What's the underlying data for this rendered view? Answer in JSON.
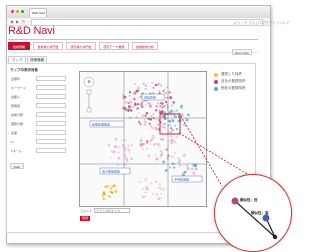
{
  "browser": {
    "tab_label": "R&D Navi",
    "back_glyph": "◀",
    "forward_glyph": "▶",
    "reload_glyph": "↻"
  },
  "header": {
    "brand": "R&D Navi",
    "user_links": "ようこそ さん  | ログアウト  | ヘルプ"
  },
  "main_tabs": [
    "技術俯瞰",
    "技術者の専門性",
    "研究者の専門性",
    "研究テーマ推薦",
    "技術動向分析"
  ],
  "reset_label": "Reset filter",
  "sub_tabs": [
    "マップ",
    "詳細情報"
  ],
  "filter": {
    "heading": "マップの表示対象",
    "rows": [
      "出願年",
      "キーワード",
      "出願人",
      "発明者",
      "技術分野",
      "国際分類",
      "記事",
      "FI",
      "Fターム"
    ],
    "button": "Filter"
  },
  "map": {
    "labels": [
      "画像処理関連",
      "通信技術",
      "電子部品関連",
      "半導体関連"
    ]
  },
  "legend": {
    "items": [
      {
        "label": "選択した特許",
        "color": "#f2c12e"
      },
      {
        "label": "自社の登録特許",
        "color": "#b5487f"
      },
      {
        "label": "他社の登録特許",
        "color": "#5aa9c9"
      }
    ]
  },
  "comment": {
    "label": "コメント",
    "placeholder": "クラスタ名を入力",
    "apply_label": "登録"
  },
  "zoom": {
    "label_top": "類似性：低",
    "label_bottom": "類似性：高",
    "colors": {
      "pink": "#b5487f",
      "blue": "#3f63b2",
      "dark": "#222"
    }
  },
  "colors": {
    "accent": "#c8102e"
  }
}
